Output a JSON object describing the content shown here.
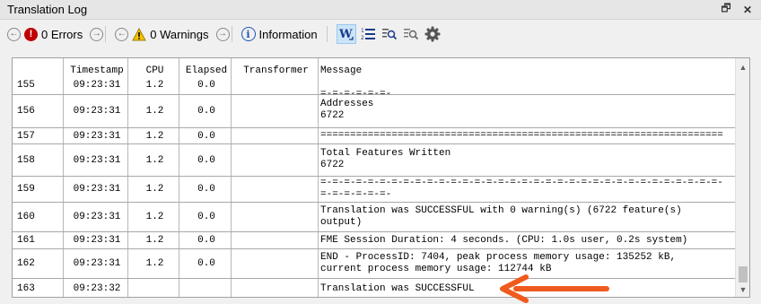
{
  "window": {
    "title": "Translation Log",
    "restore_icon": "restore-icon",
    "close_icon": "close-icon"
  },
  "toolbar": {
    "errors_label": "0 Errors",
    "warnings_label": "0 Warnings",
    "information_label": "Information",
    "error_icon_glyph": "!",
    "warning_icon_glyph": "!",
    "info_icon_glyph": "i"
  },
  "log": {
    "headers": {
      "timestamp": "Timestamp",
      "cpu": "CPU",
      "elapsed": "Elapsed",
      "transformer": "Transformer",
      "message": "Message"
    },
    "rows": [
      {
        "num": "155",
        "timestamp": "09:23:31",
        "cpu": "1.2",
        "elapsed": "0.0",
        "transformer": "",
        "message": "\n=-=-=-=-=-=-"
      },
      {
        "num": "156",
        "timestamp": "09:23:31",
        "cpu": "1.2",
        "elapsed": "0.0",
        "transformer": "",
        "message": "Addresses\n6722"
      },
      {
        "num": "157",
        "timestamp": "09:23:31",
        "cpu": "1.2",
        "elapsed": "0.0",
        "transformer": "",
        "message": "===================================================================="
      },
      {
        "num": "158",
        "timestamp": "09:23:31",
        "cpu": "1.2",
        "elapsed": "0.0",
        "transformer": "",
        "message": "Total Features Written\n6722"
      },
      {
        "num": "159",
        "timestamp": "09:23:31",
        "cpu": "1.2",
        "elapsed": "0.0",
        "transformer": "",
        "message": "=-=-=-=-=-=-=-=-=-=-=-=-=-=-=-=-=-=-=-=-=-=-=-=-=-=-=-=-=-=-=-=-=-=-\n=-=-=-=-=-=-"
      },
      {
        "num": "160",
        "timestamp": "09:23:31",
        "cpu": "1.2",
        "elapsed": "0.0",
        "transformer": "",
        "message": "Translation was SUCCESSFUL with 0 warning(s) (6722 feature(s)\noutput)"
      },
      {
        "num": "161",
        "timestamp": "09:23:31",
        "cpu": "1.2",
        "elapsed": "0.0",
        "transformer": "",
        "message": "FME Session Duration: 4 seconds. (CPU: 1.0s user, 0.2s system)"
      },
      {
        "num": "162",
        "timestamp": "09:23:31",
        "cpu": "1.2",
        "elapsed": "0.0",
        "transformer": "",
        "message": "END - ProcessID: 7404, peak process memory usage: 135252 kB,\ncurrent process memory usage: 112744 kB"
      },
      {
        "num": "163",
        "timestamp": "09:23:32",
        "cpu": "",
        "elapsed": "",
        "transformer": "",
        "message": "Translation was SUCCESSFUL"
      }
    ]
  },
  "annotation": {
    "arrow_color": "#f05a1e"
  },
  "colors": {
    "error_red": "#c00000",
    "warning_yellow": "#f5c400",
    "info_blue": "#1a56b5"
  }
}
